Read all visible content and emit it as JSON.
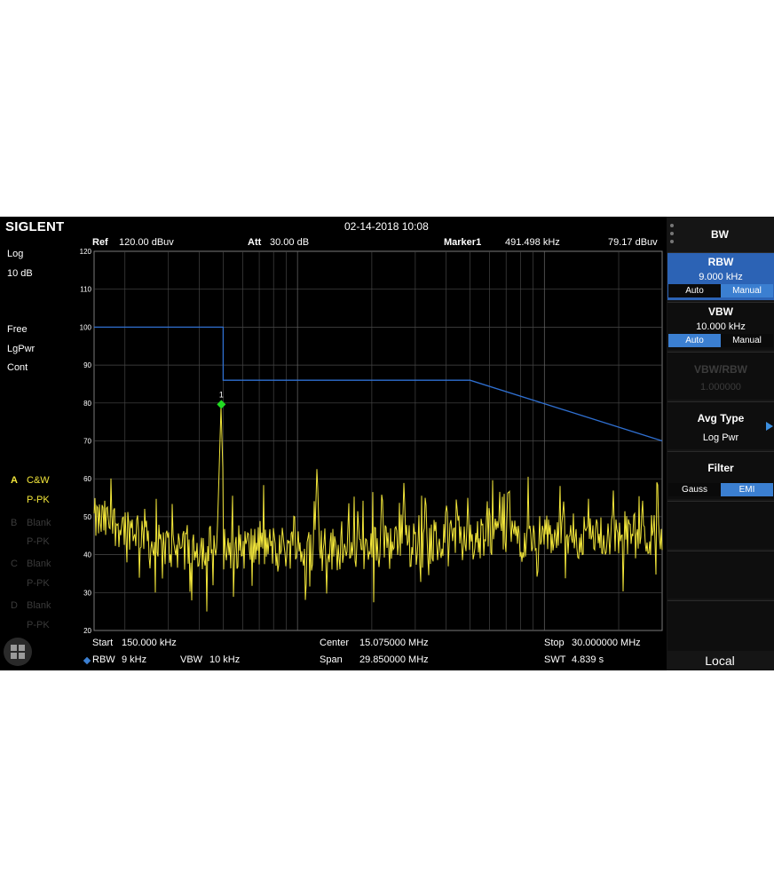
{
  "header": {
    "logo": "SIGLENT",
    "datetime": "02-14-2018 10:08"
  },
  "top_bar": {
    "ref_label": "Ref",
    "ref_value": "120.00 dBuv",
    "att_label": "Att",
    "att_value": "30.00 dB",
    "marker_label": "Marker1",
    "marker_freq": "491.498 kHz",
    "marker_level": "79.17 dBuv"
  },
  "left_status": {
    "scale": "Log",
    "div": "10 dB",
    "trig": "Free",
    "avg": "LgPwr",
    "sweep": "Cont",
    "traces": [
      {
        "letter": "A",
        "mode": "C&W",
        "det": "P-PK",
        "active": true
      },
      {
        "letter": "B",
        "mode": "Blank",
        "det": "P-PK",
        "active": false
      },
      {
        "letter": "C",
        "mode": "Blank",
        "det": "P-PK",
        "active": false
      },
      {
        "letter": "D",
        "mode": "Blank",
        "det": "P-PK",
        "active": false
      }
    ]
  },
  "bottom_bar": {
    "start_label": "Start",
    "start_value": "150.000 kHz",
    "center_label": "Center",
    "center_value": "15.075000 MHz",
    "stop_label": "Stop",
    "stop_value": "30.000000 MHz",
    "rbw_label": "RBW",
    "rbw_value": "9 kHz",
    "vbw_label": "VBW",
    "vbw_value": "10 kHz",
    "span_label": "Span",
    "span_value": "29.850000 MHz",
    "swt_label": "SWT",
    "swt_value": "4.839 s"
  },
  "menu": {
    "title": "BW",
    "rbw": {
      "title": "RBW",
      "value": "9.000 kHz",
      "opt_auto": "Auto",
      "opt_manual": "Manual",
      "selected": "Manual"
    },
    "vbw": {
      "title": "VBW",
      "value": "10.000 kHz",
      "opt_auto": "Auto",
      "opt_manual": "Manual",
      "selected": "Auto"
    },
    "vbw_rbw": {
      "title": "VBW/RBW",
      "value": "1.000000"
    },
    "avg_type": {
      "title": "Avg Type",
      "value": "Log Pwr"
    },
    "filter": {
      "title": "Filter",
      "opt_gauss": "Gauss",
      "opt_emi": "EMI",
      "selected": "EMI"
    },
    "local": "Local"
  },
  "colors": {
    "trace": "#f2e63a",
    "limit": "#2f6fd0",
    "marker": "#22dd22",
    "accent": "#3b7fd1"
  },
  "chart_data": {
    "type": "line",
    "x_scale": "log",
    "x_range_mhz": [
      0.15,
      30.0
    ],
    "ylim": [
      20,
      120
    ],
    "yticks": [
      20,
      30,
      40,
      50,
      60,
      70,
      80,
      90,
      100,
      110,
      120
    ],
    "y_unit": "dBuv",
    "grid": true,
    "limit_line": {
      "x_mhz": [
        0.15,
        0.5,
        0.5,
        5.0,
        30.0
      ],
      "y": [
        100,
        100,
        86,
        86,
        70
      ]
    },
    "marker": {
      "label": "1",
      "x_mhz": 0.491498,
      "y": 79.17
    },
    "trace_peaks": [
      {
        "x_mhz": 0.49,
        "y": 79
      },
      {
        "x_mhz": 1.2,
        "y": 64
      },
      {
        "x_mhz": 2.2,
        "y": 59
      },
      {
        "x_mhz": 2.7,
        "y": 60
      },
      {
        "x_mhz": 3.3,
        "y": 58
      },
      {
        "x_mhz": 4.0,
        "y": 56
      },
      {
        "x_mhz": 4.9,
        "y": 56
      }
    ],
    "noise_floor": 45
  }
}
